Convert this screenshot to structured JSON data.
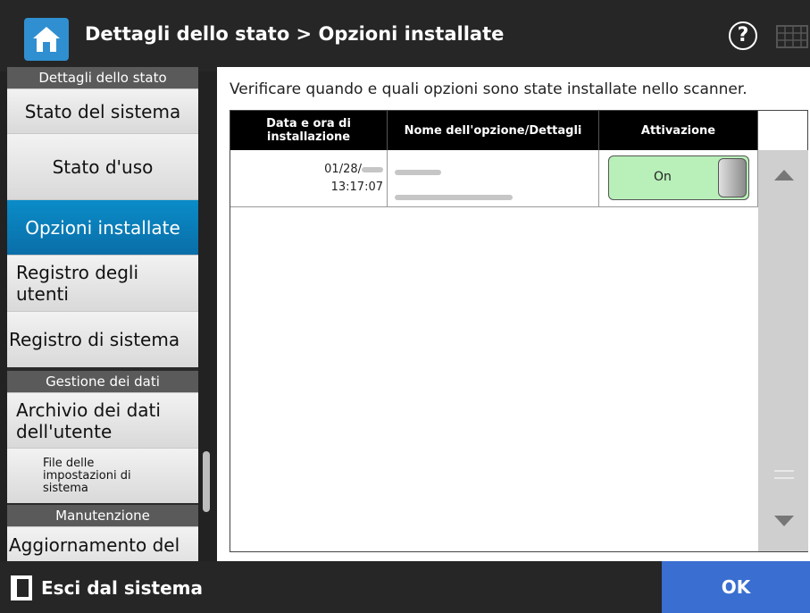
{
  "header": {
    "title": "Dettagli dello stato > Opzioni installate",
    "help_label": "?"
  },
  "sidebar": {
    "groups": [
      {
        "header": "Dettagli dello stato"
      },
      {
        "header": "Gestione dei dati"
      },
      {
        "header": "Manutenzione"
      }
    ],
    "items": [
      {
        "label": "Stato del sistema"
      },
      {
        "label": "Stato d'uso"
      },
      {
        "label": "Opzioni installate",
        "active": true
      },
      {
        "label": "Registro degli utenti"
      },
      {
        "label": "Registro di sistema"
      },
      {
        "label": "Archivio dei dati dell'utente"
      },
      {
        "label": "File delle impostazioni di sistema"
      },
      {
        "label": "Aggiornamento del"
      }
    ]
  },
  "main": {
    "description": "Verificare quando e quali opzioni sono state installate nello scanner.",
    "table": {
      "columns": [
        "Data e ora di installazione",
        "Nome dell'opzione/Dettagli",
        "Attivazione"
      ],
      "rows": [
        {
          "date": "01/28/",
          "time": "13:17:07",
          "activation": "On"
        }
      ]
    }
  },
  "footer": {
    "logout_label": "Esci dal sistema",
    "ok_label": "OK"
  },
  "colors": {
    "accent_blue": "#0a8cc8",
    "ok_button": "#3a6ed0",
    "toggle_on": "#b9f0b9"
  }
}
